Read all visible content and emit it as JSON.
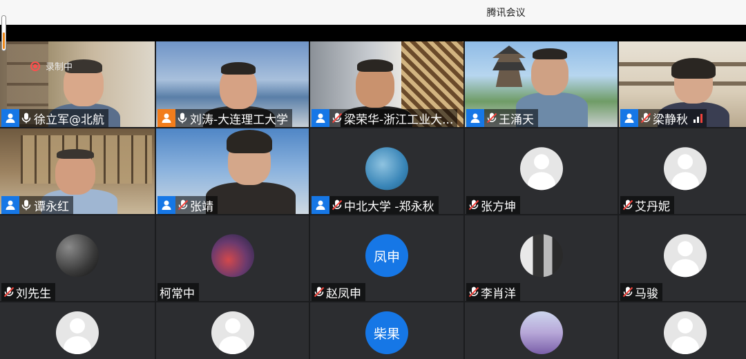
{
  "app": {
    "title": "腾讯会议"
  },
  "recording": {
    "label": "录制中"
  },
  "participants": [
    {
      "name": "徐立军@北航",
      "video": true
    },
    {
      "name": "刘涛-大连理工大学",
      "video": true
    },
    {
      "name": "梁荣华-浙江工业大...",
      "video": true
    },
    {
      "name": "王涌天",
      "video": true
    },
    {
      "name": "梁静秋",
      "video": true
    },
    {
      "name": "谭永红",
      "video": true
    },
    {
      "name": "张靖",
      "video": true
    },
    {
      "name": "中北大学 -郑永秋",
      "video": false
    },
    {
      "name": "张方坤",
      "video": false
    },
    {
      "name": "艾丹妮",
      "video": false
    },
    {
      "name": "刘先生",
      "video": false
    },
    {
      "name": "柯常中",
      "video": false
    },
    {
      "name": "赵凤申",
      "video": false,
      "avatar_text": "凤申"
    },
    {
      "name": "李肖洋",
      "video": false
    },
    {
      "name": "马骏",
      "video": false
    },
    {
      "avatar_text": "柴果"
    }
  ],
  "colors": {
    "accent_blue": "#1677e6",
    "host_orange": "#f27d1c",
    "mic_muted_red": "#f2433c"
  }
}
